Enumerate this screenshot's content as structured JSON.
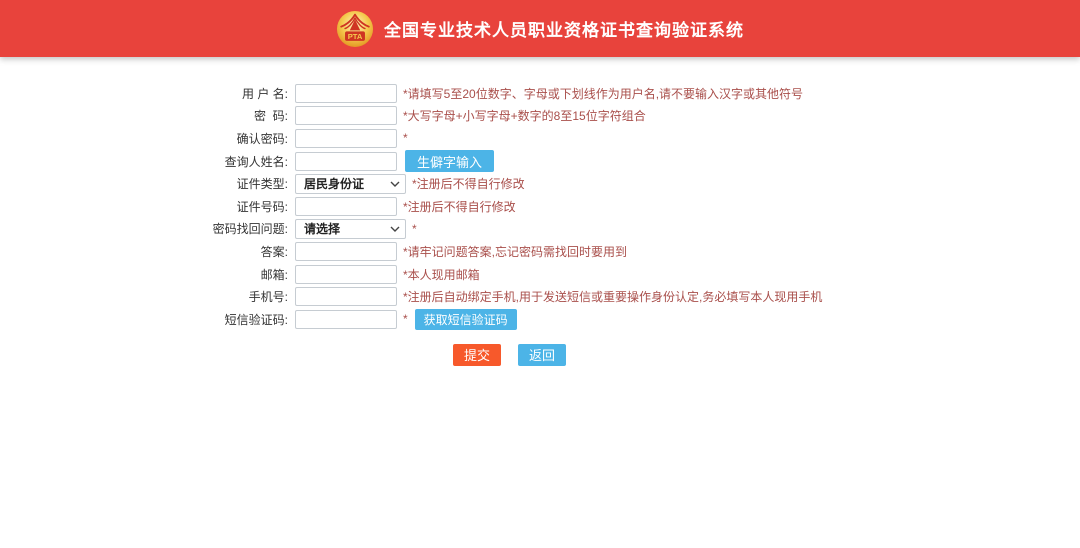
{
  "header": {
    "title": "全国专业技术人员职业资格证书查询验证系统",
    "logo_text": "PTA"
  },
  "form": {
    "rows": [
      {
        "label": "用 户 名:",
        "hint": "*请填写5至20位数字、字母或下划线作为用户名,请不要输入汉字或其他符号"
      },
      {
        "label": "密  码:",
        "hint": "*大写字母+小写字母+数字的8至15位字符组合"
      },
      {
        "label": "确认密码:",
        "hint": "*"
      },
      {
        "label": "查询人姓名:",
        "button": "生僻字输入"
      },
      {
        "label": "证件类型:",
        "value": "居民身份证",
        "hint": "*注册后不得自行修改"
      },
      {
        "label": "证件号码:",
        "hint": "*注册后不得自行修改"
      },
      {
        "label": "密码找回问题:",
        "value": "请选择",
        "hint": "*"
      },
      {
        "label": "答案:",
        "hint": "*请牢记问题答案,忘记密码需找回时要用到"
      },
      {
        "label": "邮箱:",
        "hint": "*本人现用邮箱"
      },
      {
        "label": "手机号:",
        "hint": "*注册后自动绑定手机,用于发送短信或重要操作身份认定,务必填写本人现用手机"
      },
      {
        "label": "短信验证码:",
        "hint": "*",
        "button": "获取短信验证码"
      }
    ],
    "submit_label": "提交",
    "back_label": "返回"
  },
  "colors": {
    "header_bg": "#e8433c",
    "hint_text": "#a94f4b",
    "button_blue": "#4cb4e7",
    "button_orange": "#f7592b",
    "logo_gold": "#f5c94e",
    "logo_red": "#cf3522"
  }
}
